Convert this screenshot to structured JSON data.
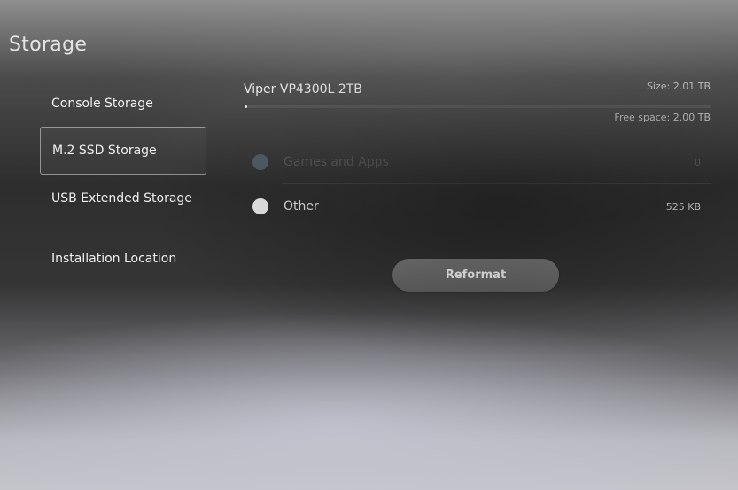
{
  "page": {
    "title": "Storage"
  },
  "sidebar": {
    "items": [
      {
        "label": "Console Storage",
        "selected": false
      },
      {
        "label": "M.2 SSD Storage",
        "selected": true
      },
      {
        "label": "USB Extended Storage",
        "selected": false
      },
      {
        "label": "Installation Location",
        "selected": false
      }
    ]
  },
  "drive": {
    "name": "Viper VP4300L 2TB",
    "size_text": "Size: 2.01 TB",
    "free_text": "Free space: 2.00 TB",
    "used_fraction": 0.005
  },
  "usage": {
    "categories": [
      {
        "label": "Games and Apps",
        "value": "0",
        "color": "#55606a",
        "enabled": false
      },
      {
        "label": "Other",
        "value": "525 KB",
        "color": "#f4f4f4",
        "enabled": true
      }
    ]
  },
  "actions": {
    "reformat_label": "Reformat"
  },
  "colors": {
    "text_primary": "#f0f0f0",
    "text_secondary": "#bdbdbd",
    "button_bg": "#6e6e6e"
  }
}
